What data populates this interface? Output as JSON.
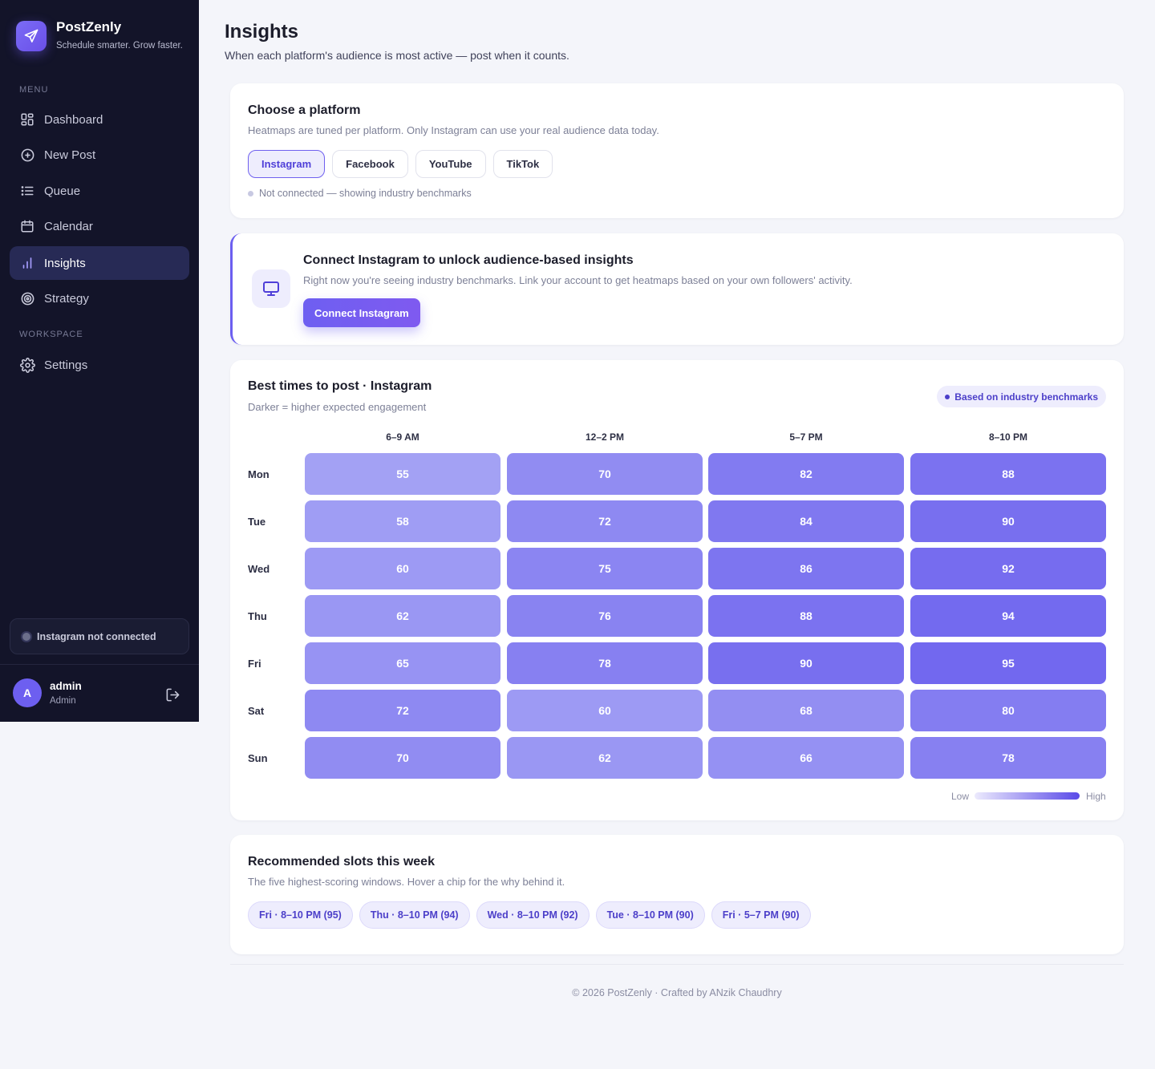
{
  "brand": {
    "name": "PostZenly",
    "tagline": "Schedule smarter. Grow faster."
  },
  "sidebar": {
    "menu_label": "MENU",
    "workspace_label": "WORKSPACE",
    "items": [
      {
        "label": "Dashboard",
        "icon": "dashboard-icon"
      },
      {
        "label": "New Post",
        "icon": "plus-circle-icon"
      },
      {
        "label": "Queue",
        "icon": "list-icon"
      },
      {
        "label": "Calendar",
        "icon": "calendar-icon"
      },
      {
        "label": "Insights",
        "icon": "bar-chart-icon",
        "active": true
      },
      {
        "label": "Strategy",
        "icon": "target-icon"
      }
    ],
    "workspace_items": [
      {
        "label": "Settings",
        "icon": "gear-icon"
      }
    ],
    "status": "Instagram not connected",
    "user": {
      "initial": "A",
      "name": "admin",
      "role": "Admin"
    }
  },
  "header": {
    "title": "Insights",
    "subtitle": "When each platform's audience is most active — post when it counts."
  },
  "platform_card": {
    "title": "Choose a platform",
    "subtitle": "Heatmaps are tuned per platform. Only Instagram can use your real audience data today.",
    "tabs": [
      "Instagram",
      "Facebook",
      "YouTube",
      "TikTok"
    ],
    "selected": "Instagram",
    "note": "Not connected — showing industry benchmarks"
  },
  "connect_card": {
    "title": "Connect Instagram to unlock audience-based insights",
    "subtitle": "Right now you're seeing industry benchmarks. Link your account to get heatmaps based on your own followers' activity.",
    "button": "Connect Instagram"
  },
  "heatmap_card": {
    "title": "Best times to post · Instagram",
    "subtitle": "Darker = higher expected engagement",
    "badge": "Based on industry benchmarks",
    "legend_low": "Low",
    "legend_high": "High"
  },
  "chart_data": {
    "type": "heatmap",
    "title": "Best times to post · Instagram",
    "x_categories": [
      "6–9 AM",
      "12–2 PM",
      "5–7 PM",
      "8–10 PM"
    ],
    "y_categories": [
      "Mon",
      "Tue",
      "Wed",
      "Thu",
      "Fri",
      "Sat",
      "Sun"
    ],
    "values": [
      [
        55,
        70,
        82,
        88
      ],
      [
        58,
        72,
        84,
        90
      ],
      [
        60,
        75,
        86,
        92
      ],
      [
        62,
        76,
        88,
        94
      ],
      [
        65,
        78,
        90,
        95
      ],
      [
        72,
        60,
        68,
        80
      ],
      [
        70,
        62,
        66,
        78
      ]
    ],
    "colors": {
      "low": "#a9a8f5",
      "high": "#6c61ee"
    }
  },
  "recommended": {
    "title": "Recommended slots this week",
    "subtitle": "The five highest-scoring windows. Hover a chip for the why behind it.",
    "chips": [
      "Fri · 8–10 PM (95)",
      "Thu · 8–10 PM (94)",
      "Wed · 8–10 PM (92)",
      "Tue · 8–10 PM (90)",
      "Fri · 5–7 PM (90)"
    ]
  },
  "footer": "© 2026 PostZenly · Crafted by ANzik Chaudhry"
}
